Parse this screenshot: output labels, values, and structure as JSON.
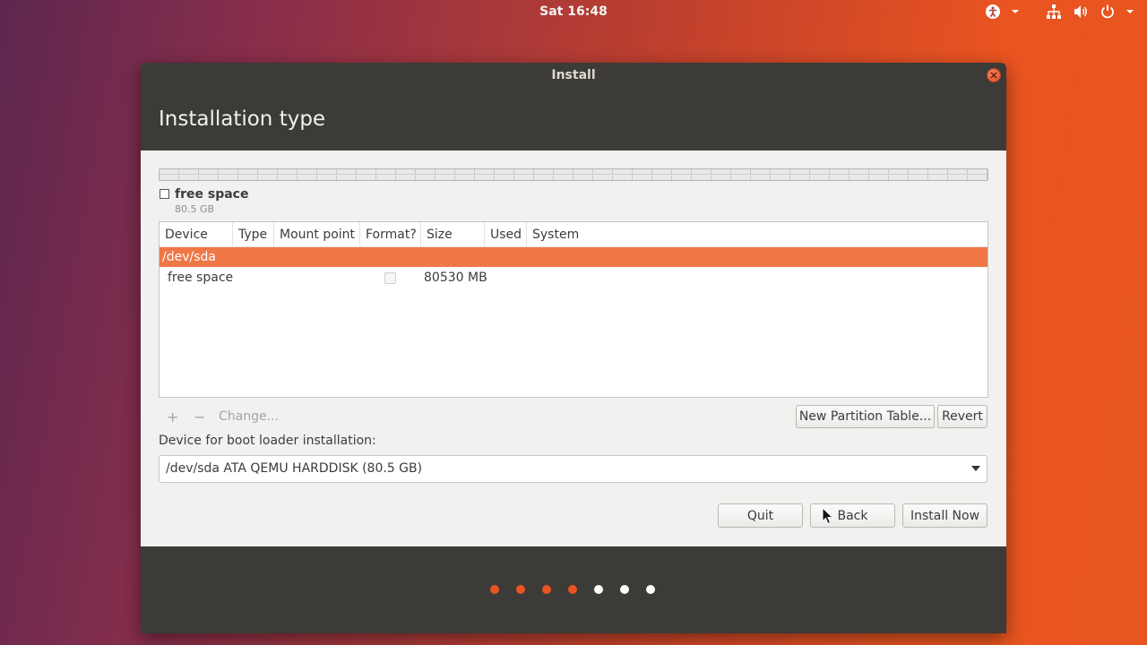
{
  "topbar": {
    "clock": "Sat 16:48",
    "icons": [
      "accessibility-icon",
      "network-icon",
      "volume-icon",
      "power-icon"
    ]
  },
  "window": {
    "title": "Install",
    "heading": "Installation type"
  },
  "partition_bar": {
    "legend_name": "free space",
    "legend_size": "80.5 GB"
  },
  "table": {
    "columns": [
      "Device",
      "Type",
      "Mount point",
      "Format?",
      "Size",
      "Used",
      "System"
    ],
    "selected_row": "/dev/sda",
    "rows": [
      {
        "device": "free space",
        "format": false,
        "size": "80530 MB"
      }
    ]
  },
  "toolbar": {
    "add": "+",
    "remove": "−",
    "change": "Change...",
    "new_partition_table": "New Partition Table...",
    "revert": "Revert"
  },
  "boot": {
    "label": "Device for boot loader installation:",
    "selected": "/dev/sda ATA QEMU HARDDISK (80.5 GB)"
  },
  "buttons": {
    "quit": "Quit",
    "back": "Back",
    "install_now": "Install Now"
  },
  "progress": {
    "total_steps": 7,
    "completed_steps": 4,
    "active_color": "#e95420",
    "inactive_color": "#ffffff"
  },
  "colors": {
    "accent": "#e95420",
    "selection": "#f07746"
  }
}
